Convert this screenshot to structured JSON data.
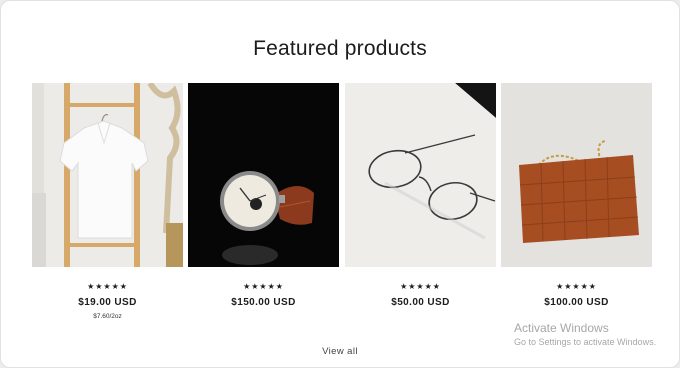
{
  "section": {
    "title": "Featured products"
  },
  "products": [
    {
      "image": "white-polo-shirt-on-wooden-ladder",
      "rating": "★★★★★",
      "price": "$19.00 USD",
      "unit_price": "$7.60/2oz"
    },
    {
      "image": "wristwatch-on-black",
      "rating": "★★★★★",
      "price": "$150.00 USD"
    },
    {
      "image": "eyeglasses-on-white",
      "rating": "★★★★★",
      "price": "$50.00 USD"
    },
    {
      "image": "brown-woven-leather-bag",
      "rating": "★★★★★",
      "price": "$100.00 USD"
    }
  ],
  "footer": {
    "view_all": "View all"
  },
  "watermark": {
    "line1": "Activate Windows",
    "line2": "Go to Settings to activate Windows."
  }
}
